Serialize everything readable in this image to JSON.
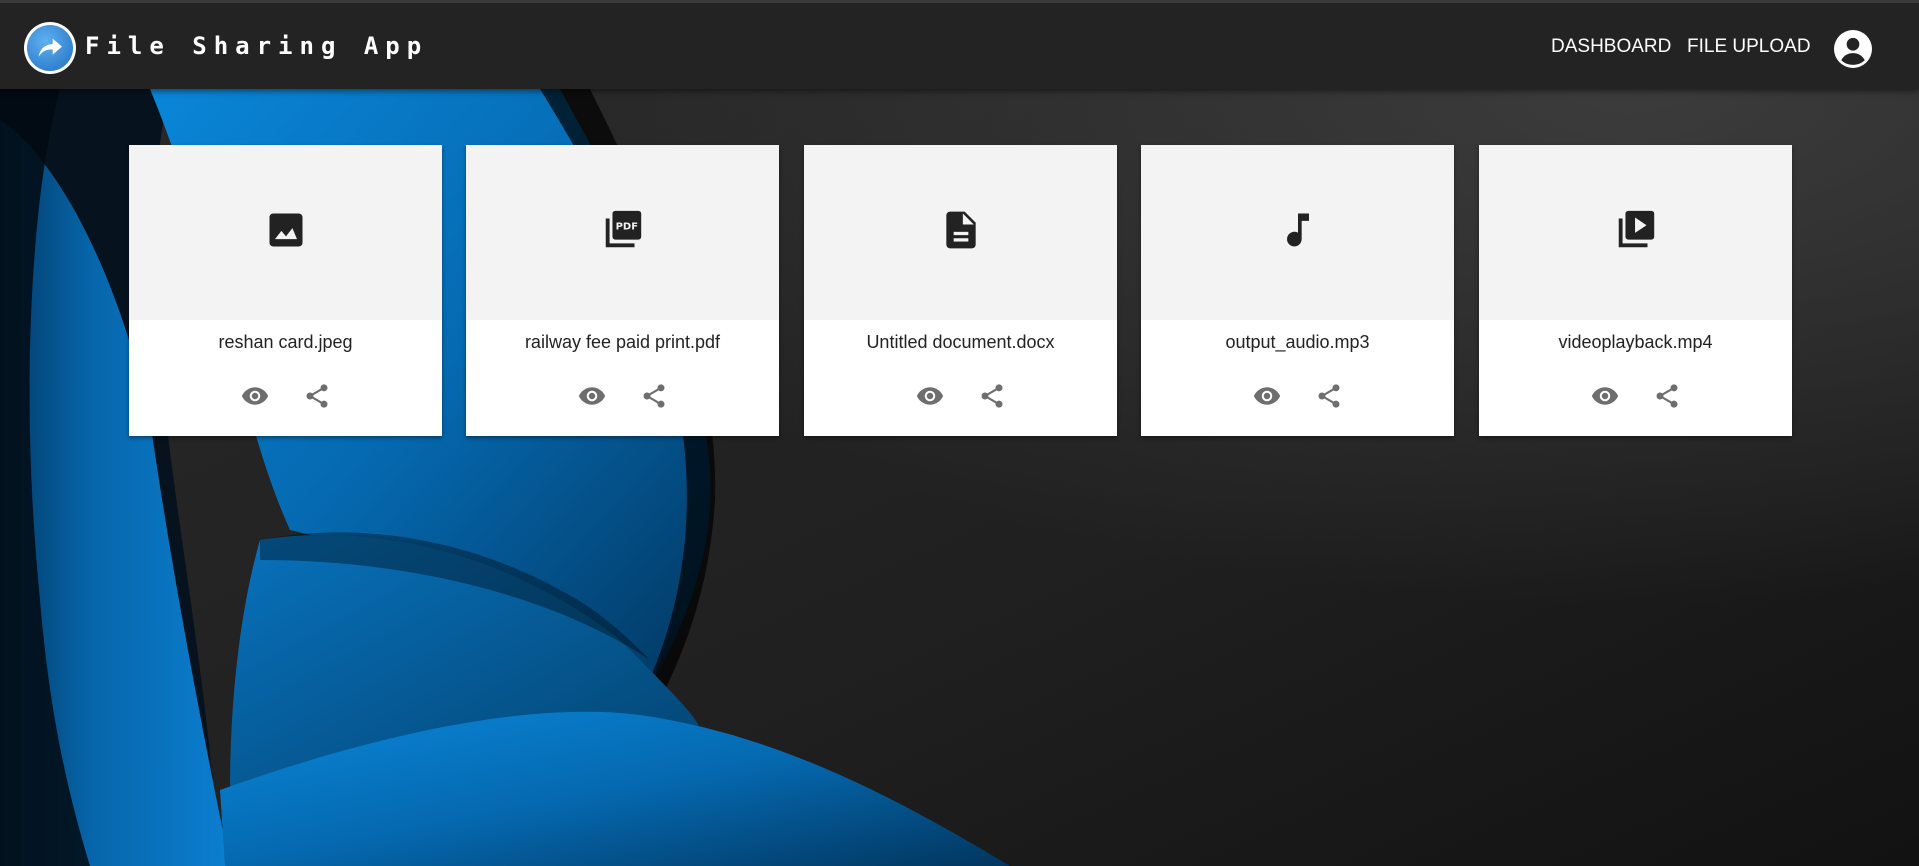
{
  "header": {
    "app_title": "File Sharing App",
    "logo_icon": "share-arrow-icon",
    "nav": [
      {
        "label": "DASHBOARD"
      },
      {
        "label": "FILE UPLOAD"
      }
    ],
    "account_icon": "account-circle-icon"
  },
  "files": [
    {
      "name": "reshan card.jpeg",
      "icon": "image-icon"
    },
    {
      "name": "railway fee paid print.pdf",
      "icon": "pdf-icon"
    },
    {
      "name": "Untitled document.docx",
      "icon": "document-icon"
    },
    {
      "name": "output_audio.mp3",
      "icon": "music-note-icon"
    },
    {
      "name": "videoplayback.mp4",
      "icon": "video-library-icon"
    }
  ],
  "card_actions": {
    "view_icon": "eye-icon",
    "share_icon": "share-icon"
  },
  "colors": {
    "navbar": "#232323",
    "accent_blue": "#0a72c4",
    "card_media_bg": "#f3f3f3",
    "icon_dark": "#222222",
    "action_icon": "#6e6e6e"
  }
}
